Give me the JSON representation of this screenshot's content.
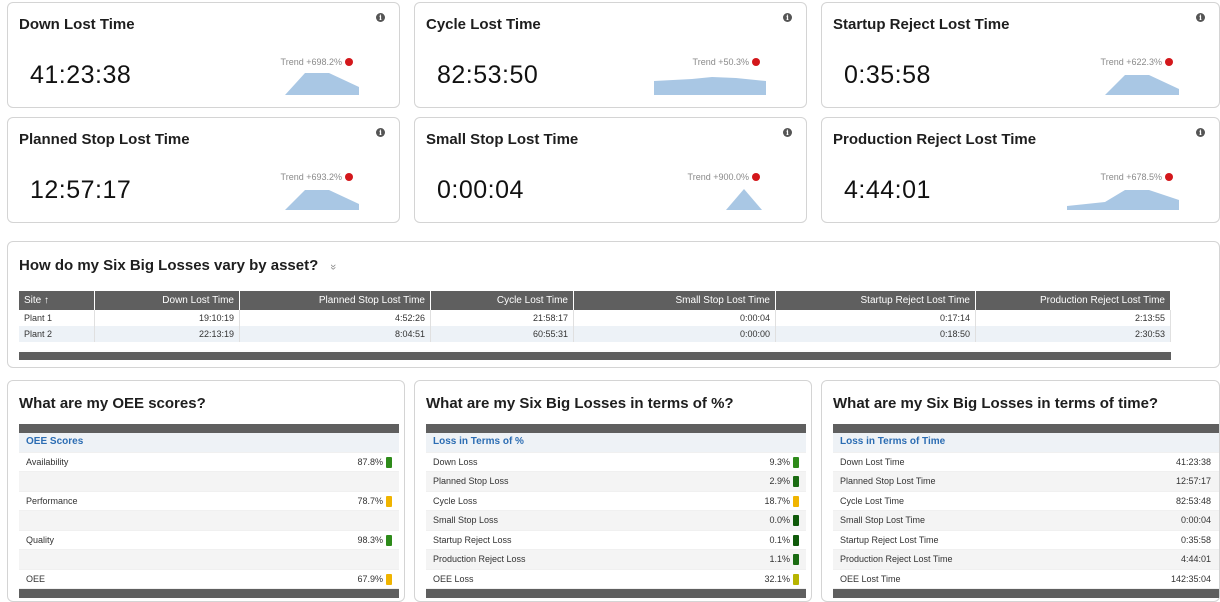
{
  "kpis": [
    {
      "title": "Down Lost Time",
      "value": "41:23:38",
      "trend": "Trend +698.2%"
    },
    {
      "title": "Cycle Lost Time",
      "value": "82:53:50",
      "trend": "Trend +50.3%"
    },
    {
      "title": "Startup Reject Lost Time",
      "value": "0:35:58",
      "trend": "Trend +622.3%"
    },
    {
      "title": "Planned Stop Lost Time",
      "value": "12:57:17",
      "trend": "Trend +693.2%"
    },
    {
      "title": "Small Stop Lost Time",
      "value": "0:00:04",
      "trend": "Trend +900.0%"
    },
    {
      "title": "Production Reject Lost Time",
      "value": "4:44:01",
      "trend": "Trend +678.5%"
    }
  ],
  "colors": {
    "trend_dot": "#d3171b",
    "spark": "#a9c7e4",
    "header": "#5f5f5f",
    "green": "#2e8b1a",
    "amber": "#f0b400",
    "link": "#2c6db3"
  },
  "info_icon": "i",
  "asset_section": {
    "title": "How do my Six Big Losses vary by asset?",
    "toggle": "»",
    "columns": [
      "Site ↑",
      "Down Lost Time",
      "Planned Stop Lost Time",
      "Cycle Lost Time",
      "Small Stop Lost Time",
      "Startup Reject Lost Time",
      "Production Reject Lost Time"
    ],
    "rows": [
      [
        "Plant 1",
        "19:10:19",
        "4:52:26",
        "21:58:17",
        "0:00:04",
        "0:17:14",
        "2:13:55"
      ],
      [
        "Plant 2",
        "22:13:19",
        "8:04:51",
        "60:55:31",
        "0:00:00",
        "0:18:50",
        "2:30:53"
      ]
    ]
  },
  "oee": {
    "title": "What are my OEE scores?",
    "header": "OEE Scores",
    "rows": [
      {
        "label": "Availability",
        "value": "87.8%",
        "status": "green"
      },
      {
        "label": "",
        "value": "",
        "status": ""
      },
      {
        "label": "Performance",
        "value": "78.7%",
        "status": "amber"
      },
      {
        "label": "",
        "value": "",
        "status": ""
      },
      {
        "label": "Quality",
        "value": "98.3%",
        "status": "green"
      },
      {
        "label": "",
        "value": "",
        "status": ""
      },
      {
        "label": "OEE",
        "value": "67.9%",
        "status": "amber"
      }
    ]
  },
  "loss_pct": {
    "title": "What are my Six Big Losses in terms of %?",
    "header": "Loss in Terms of %",
    "rows": [
      {
        "label": "Down Loss",
        "value": "9.3%",
        "status": "green"
      },
      {
        "label": "Planned Stop Loss",
        "value": "2.9%",
        "status": "green"
      },
      {
        "label": "Cycle Loss",
        "value": "18.7%",
        "status": "amber"
      },
      {
        "label": "Small Stop Loss",
        "value": "0.0%",
        "status": "green"
      },
      {
        "label": "Startup Reject Loss",
        "value": "0.1%",
        "status": "green"
      },
      {
        "label": "Production Reject Loss",
        "value": "1.1%",
        "status": "green"
      },
      {
        "label": "OEE Loss",
        "value": "32.1%",
        "status": "amber"
      }
    ]
  },
  "loss_time": {
    "title": "What are my Six Big Losses in terms of time?",
    "header": "Loss in Terms of Time",
    "rows": [
      {
        "label": "Down Lost Time",
        "value": "41:23:38"
      },
      {
        "label": "Planned Stop Lost Time",
        "value": "12:57:17"
      },
      {
        "label": "Cycle Lost Time",
        "value": "82:53:48"
      },
      {
        "label": "Small Stop Lost Time",
        "value": "0:00:04"
      },
      {
        "label": "Startup Reject Lost Time",
        "value": "0:35:58"
      },
      {
        "label": "Production Reject Lost Time",
        "value": "4:44:01"
      },
      {
        "label": "OEE Lost Time",
        "value": "142:35:04"
      }
    ]
  }
}
